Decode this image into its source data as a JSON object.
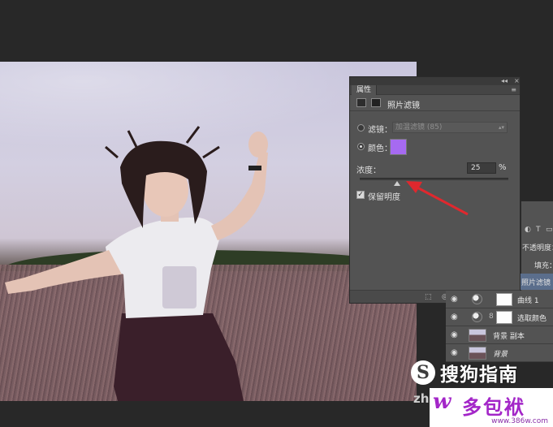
{
  "panel": {
    "tab_label": "属性",
    "collapse_glyph": "◂◂",
    "close_glyph": "×",
    "menu_glyph": "≡",
    "title": "照片滤镜",
    "filter_label": "滤镜：",
    "filter_value": "加温滤镜 (85)",
    "color_label": "颜色：",
    "selected_mode": "color",
    "swatch_color": "#a66af1",
    "density_label": "浓度：",
    "density_value": "25",
    "density_unit": "%",
    "density_fraction": 0.25,
    "preserve_label": "保留明度",
    "preserve_checked": true
  },
  "layers": {
    "tool_text_icon": "T",
    "side_labels": {
      "opacity": "不透明度：",
      "fill": "填充：",
      "selected_layer": "照片滤镜"
    },
    "rows": [
      {
        "name": "曲线 1",
        "type": "adjustment"
      },
      {
        "name": "选取颜色",
        "type": "adjustment"
      },
      {
        "name": "背景 副本",
        "type": "image"
      },
      {
        "name": "背景",
        "type": "image",
        "italic": true
      }
    ]
  },
  "watermarks": {
    "sogou_badge": "S",
    "sogou_text": "搜狗指南",
    "zhi_text": "zhi",
    "site_logo": "w",
    "site_name": "多包袱",
    "site_url": "www.386w.com"
  },
  "colors": {
    "app_background": "#282828",
    "panel_background": "#535353",
    "selection_blue": "#5b6e8c",
    "annotation_arrow": "#e0282e"
  }
}
